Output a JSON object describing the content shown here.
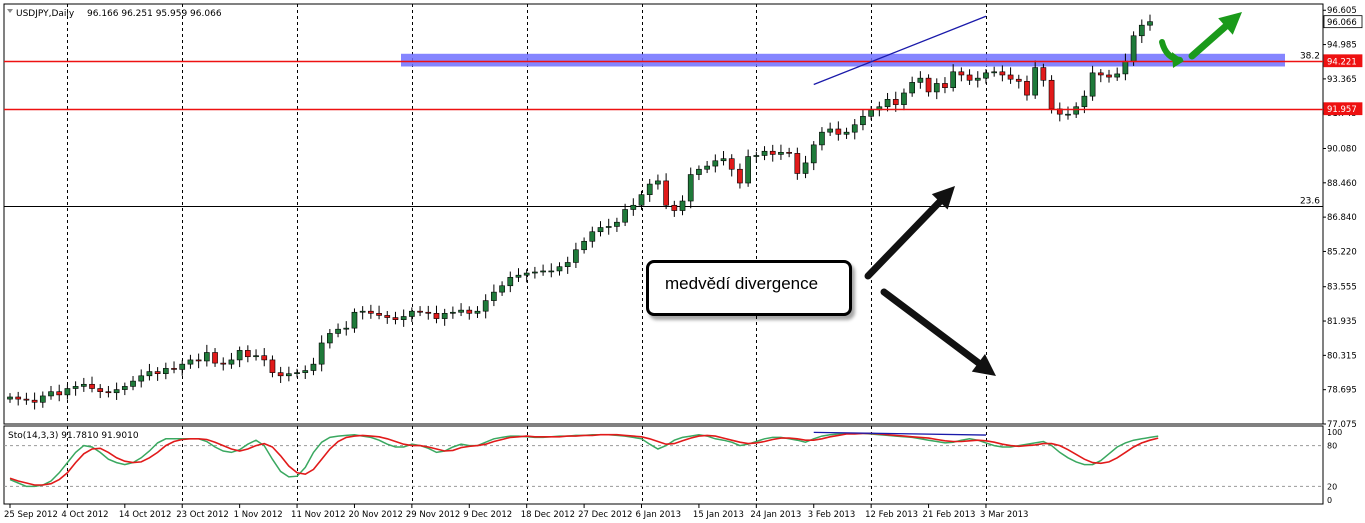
{
  "chart_data": [
    {
      "type": "candlestick",
      "title": "USDJPY,Daily",
      "ohlc_readout": "96.166 96.251 95.959 96.066",
      "ylim": [
        77.075,
        96.9
      ],
      "y_ticks": [
        "96.605",
        "94.985",
        "93.365",
        "91.745",
        "90.080",
        "88.460",
        "86.840",
        "85.220",
        "83.555",
        "81.935",
        "80.315",
        "78.695",
        "77.075"
      ],
      "x_ticks": [
        "25 Sep 2012",
        "4 Oct 2012",
        "14 Oct 2012",
        "23 Oct 2012",
        "1 Nov 2012",
        "11 Nov 2012",
        "20 Nov 2012",
        "29 Nov 2012",
        "9 Dec 2012",
        "18 Dec 2012",
        "27 Dec 2012",
        "6 Jan 2013",
        "15 Jan 2013",
        "24 Jan 2013",
        "3 Feb 2013",
        "12 Feb 2013",
        "21 Feb 2013",
        "3 Mar 2013"
      ],
      "grid": true,
      "price_labels": [
        {
          "value": 96.066,
          "text": "96.066",
          "style": "current"
        },
        {
          "value": 94.221,
          "text": "94.221",
          "style": "red"
        },
        {
          "value": 91.957,
          "text": "91.957",
          "style": "red"
        }
      ],
      "fib_levels": [
        {
          "value": 94.221,
          "label": "38.2"
        },
        {
          "value": 87.35,
          "label": "23.6"
        }
      ],
      "horizontal_lines": [
        94.221,
        91.957
      ],
      "resistance_zone": [
        93.95,
        94.55
      ],
      "divergence_line": [
        {
          "x": "3 Feb 2013",
          "y": 93.1
        },
        {
          "x": "3 Mar 2013",
          "y": 96.32
        }
      ],
      "close": [
        78.35,
        78.25,
        78.2,
        78.1,
        78.4,
        78.6,
        78.45,
        78.75,
        78.85,
        78.95,
        78.75,
        78.6,
        78.55,
        78.7,
        78.85,
        79.1,
        79.35,
        79.55,
        79.45,
        79.7,
        79.65,
        79.9,
        80.1,
        80.05,
        80.45,
        79.95,
        79.9,
        80.1,
        80.55,
        80.25,
        80.3,
        80.1,
        79.5,
        79.35,
        79.45,
        79.5,
        79.6,
        79.9,
        80.9,
        81.35,
        81.55,
        81.6,
        82.35,
        82.4,
        82.3,
        82.2,
        82.1,
        82.0,
        82.15,
        82.4,
        82.35,
        82.3,
        82.05,
        82.3,
        82.35,
        82.45,
        82.3,
        82.4,
        82.9,
        83.3,
        83.6,
        84.0,
        84.1,
        84.2,
        84.25,
        84.3,
        84.3,
        84.5,
        84.7,
        85.3,
        85.7,
        86.15,
        86.35,
        86.4,
        86.6,
        87.2,
        87.4,
        87.9,
        88.4,
        88.55,
        87.4,
        87.15,
        87.6,
        88.85,
        89.1,
        89.25,
        89.5,
        89.6,
        89.1,
        88.45,
        89.7,
        89.75,
        89.95,
        89.8,
        89.9,
        89.85,
        88.9,
        89.4,
        90.25,
        90.85,
        91.0,
        90.75,
        90.85,
        91.2,
        91.6,
        91.9,
        92.05,
        92.4,
        92.15,
        92.7,
        93.2,
        93.4,
        92.75,
        93.15,
        92.95,
        93.7,
        93.55,
        93.3,
        93.4,
        93.65,
        93.7,
        93.55,
        93.35,
        93.25,
        92.6,
        93.9,
        93.3,
        91.95,
        91.7,
        91.7,
        92.05,
        92.55,
        93.65,
        93.55,
        93.45,
        93.6,
        94.2,
        95.4,
        95.9,
        96.066
      ],
      "stochastic": {
        "label": "Sto(14,3,3) 91.7810 91.9010",
        "levels": [
          "100",
          "80",
          "20",
          "0"
        ],
        "ylim": [
          0,
          100
        ],
        "k": [
          30,
          25,
          20,
          20,
          22,
          28,
          40,
          55,
          70,
          80,
          78,
          70,
          60,
          55,
          52,
          55,
          62,
          72,
          84,
          90,
          90,
          90,
          90,
          90,
          86,
          78,
          72,
          70,
          74,
          82,
          88,
          80,
          60,
          42,
          34,
          35,
          48,
          70,
          85,
          92,
          94,
          95,
          96,
          94,
          92,
          88,
          82,
          78,
          78,
          82,
          80,
          76,
          70,
          72,
          78,
          82,
          80,
          80,
          85,
          90,
          92,
          94,
          94,
          93,
          92,
          92,
          93,
          94,
          94,
          95,
          95,
          96,
          96,
          96,
          95,
          94,
          92,
          90,
          82,
          75,
          80,
          88,
          92,
          94,
          96,
          94,
          90,
          88,
          85,
          80,
          82,
          86,
          90,
          92,
          92,
          90,
          88,
          85,
          90,
          94,
          96,
          97,
          98,
          98,
          98,
          97,
          96,
          95,
          94,
          93,
          92,
          90,
          88,
          86,
          84,
          85,
          88,
          90,
          88,
          84,
          80,
          78,
          78,
          80,
          82,
          84,
          86,
          80,
          70,
          62,
          56,
          52,
          52,
          58,
          68,
          78,
          84,
          88,
          90,
          92,
          94
        ],
        "d": [
          32,
          28,
          25,
          22,
          22,
          24,
          30,
          40,
          55,
          68,
          75,
          76,
          70,
          62,
          57,
          55,
          56,
          62,
          70,
          80,
          86,
          89,
          90,
          90,
          89,
          85,
          80,
          75,
          72,
          75,
          80,
          83,
          78,
          65,
          50,
          40,
          38,
          45,
          60,
          75,
          86,
          92,
          94,
          95,
          94,
          93,
          90,
          86,
          82,
          80,
          80,
          78,
          75,
          72,
          73,
          77,
          79,
          80,
          82,
          86,
          89,
          92,
          93,
          94,
          93,
          93,
          93,
          93,
          94,
          94,
          95,
          95,
          96,
          96,
          96,
          95,
          94,
          93,
          90,
          86,
          82,
          83,
          87,
          91,
          94,
          95,
          94,
          91,
          88,
          85,
          83,
          84,
          86,
          89,
          91,
          91,
          90,
          88,
          88,
          90,
          93,
          95,
          97,
          97,
          98,
          98,
          97,
          96,
          95,
          94,
          93,
          92,
          91,
          89,
          87,
          86,
          86,
          87,
          88,
          87,
          85,
          82,
          80,
          79,
          80,
          81,
          83,
          83,
          80,
          74,
          67,
          60,
          55,
          54,
          56,
          62,
          70,
          78,
          84,
          88,
          91
        ],
        "divergence_line": [
          {
            "x": "3 Feb 2013",
            "y": 99.5
          },
          {
            "x": "3 Mar 2013",
            "y": 95.5
          }
        ]
      }
    }
  ],
  "annotation": {
    "text": "medvědí divergence"
  },
  "colors": {
    "bull": "#1f7a3a",
    "bear": "#e11a1a",
    "resistance_line": "#e11",
    "zone": "#7070ff",
    "divergence": "#1a1aaa",
    "stoch_k": "#3aa860",
    "stoch_d": "#e11a1a",
    "arrow_black": "#111",
    "arrow_green": "#1a9a1a"
  }
}
